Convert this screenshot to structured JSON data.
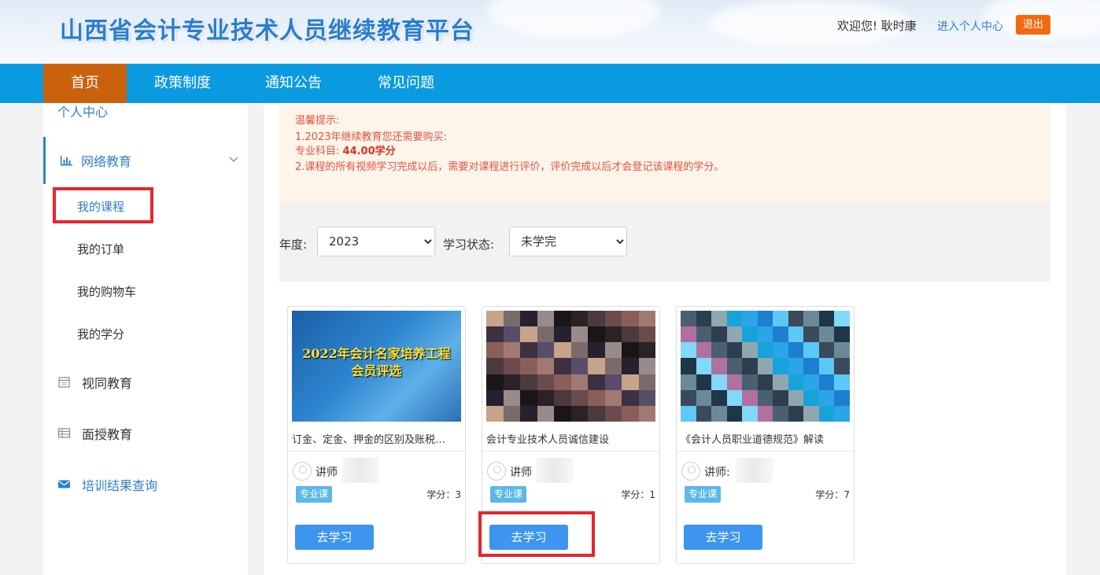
{
  "header": {
    "site_title": "山西省会计专业技术人员继续教育平台",
    "welcome": "欢迎您! 耿时康",
    "user_center_link": "进入个人中心",
    "logout_label": "退出"
  },
  "nav": {
    "items": [
      {
        "label": "首页",
        "active": true
      },
      {
        "label": "政策制度"
      },
      {
        "label": "通知公告"
      },
      {
        "label": "常见问题"
      }
    ]
  },
  "sidebar": {
    "personal_center": "个人中心",
    "online_edu": {
      "label": "网络教育",
      "icon": "bar-chart-icon"
    },
    "sub_items": [
      "我的课程",
      "我的订单",
      "我的购物车",
      "我的学分"
    ],
    "video_edu": {
      "label": "视同教育",
      "icon": "calendar-icon"
    },
    "classroom_edu": {
      "label": "面授教育",
      "icon": "table-icon"
    },
    "result_query": {
      "label": "培训结果查询",
      "icon": "envelope-icon"
    }
  },
  "tips": {
    "title": "温馨提示:",
    "line1": "1.2023年继续教育您还需要购买:",
    "line2_prefix": "专业科目:",
    "line2_value": "44.00学分",
    "line3": "2.课程的所有视频学习完成以后，需要对课程进行评价，评价完成以后才会登记该课程的学分。"
  },
  "filter": {
    "year_label": "年度:",
    "year_value": "2023",
    "status_label": "学习状态:",
    "status_value": "未学完"
  },
  "courses": [
    {
      "thumb_text_line1": "2022年会计名家培养工程",
      "thumb_text_line2": "会员评选",
      "title": "订金、定金、押金的区别及账税…",
      "lecturer_label": "讲师",
      "tag": "专业课",
      "credit": "学分：3",
      "button": "去学习"
    },
    {
      "title": "会计专业技术人员诚信建设",
      "lecturer_label": "讲师",
      "tag": "专业课",
      "credit": "学分：1",
      "button": "去学习"
    },
    {
      "title": "《会计人员职业道德规范》解读",
      "lecturer_label": "讲师:",
      "tag": "专业课",
      "credit": "学分：7",
      "button": "去学习"
    }
  ],
  "colors": {
    "nav_bg": "#0a9ae0",
    "nav_active": "#c9610d",
    "accent_blue": "#2f80c9",
    "logout_orange": "#f26a10",
    "highlight_red": "#e6262d",
    "button_blue": "#3d95ef"
  }
}
